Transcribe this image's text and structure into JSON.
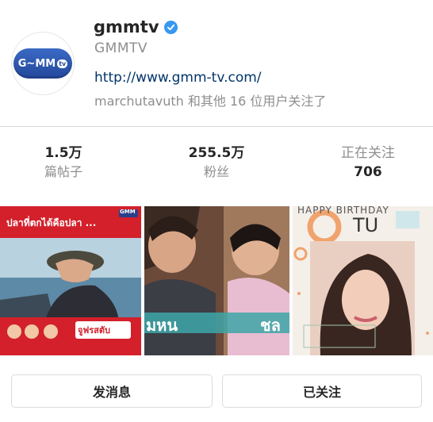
{
  "profile": {
    "username": "gmmtv",
    "full_name": "GMMTV",
    "website": "http://www.gmm-tv.com/",
    "followed_by": "marchutavuth 和其他 16 位用户关注了",
    "avatar_logo_text": "G~MM",
    "avatar_logo_tv": "tv"
  },
  "stats": {
    "posts": {
      "value": "1.5万",
      "label": "篇帖子"
    },
    "followers": {
      "value": "255.5万",
      "label": "粉丝"
    },
    "following": {
      "label": "正在关注",
      "value": "706"
    }
  },
  "posts": [
    {
      "overlay_text": "ปลาที่ตกได้คือปลา ...",
      "badge": "GMM",
      "logo_text": "จูฟรสตับ"
    },
    {
      "overlay_left": "มหน",
      "overlay_right": "ชล"
    },
    {
      "headline": "HAPPY BIRTHDAY",
      "name": "TU"
    }
  ],
  "actions": {
    "message_label": "发消息",
    "following_label": "已关注"
  },
  "colors": {
    "link": "#003569",
    "muted": "#8e8e8e",
    "verified": "#3897f0",
    "logo_blue": "#23489b",
    "post_red": "#d3202a"
  }
}
